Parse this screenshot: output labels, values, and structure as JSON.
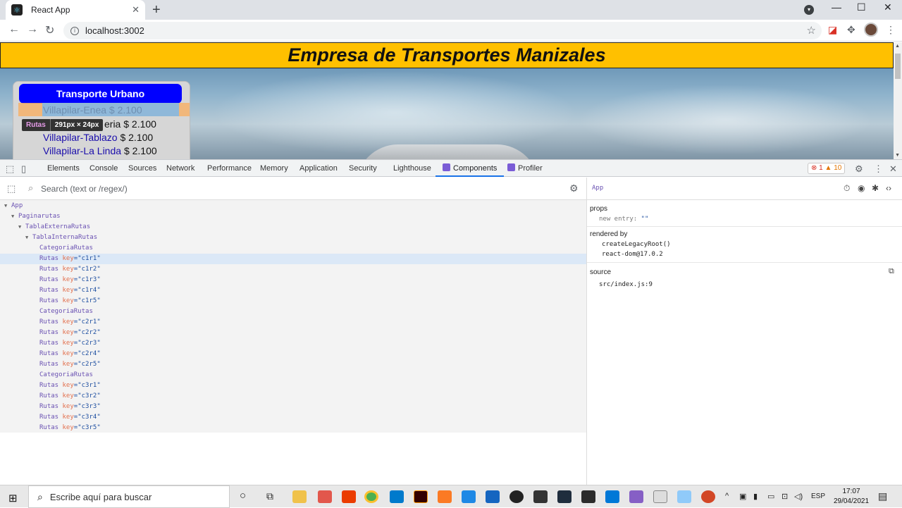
{
  "browser": {
    "tab_title": "React App",
    "tab_close": "✕",
    "new_tab": "+",
    "minimize": "—",
    "maximize": "☐",
    "close": "✕",
    "url": "localhost:3002"
  },
  "page": {
    "title": "Empresa de Transportes Manizales",
    "card_header": "Transporte Urbano",
    "routes": [
      {
        "name": "Villapilar-Enea",
        "price": "$ 2.100"
      },
      {
        "name": "Villapilar-Galeria",
        "price": "$ 2.100"
      },
      {
        "name": "Villapilar-Tablazo",
        "price": "$ 2.100"
      },
      {
        "name": "Villapilar-La Linda",
        "price": "$ 2.100"
      }
    ],
    "route2_visible": "eria $ 2.100",
    "tooltip": {
      "name": "Rutas",
      "size": "291px × 24px"
    }
  },
  "devtools": {
    "tabs": [
      "Elements",
      "Console",
      "Sources",
      "Network",
      "Performance",
      "Memory",
      "Application",
      "Security",
      "Lighthouse",
      "Components",
      "Profiler"
    ],
    "active_tab": "Components",
    "errors": "1",
    "warnings": "10",
    "search_placeholder": "Search (text or /regex/)",
    "tree": [
      {
        "name": "App",
        "depth": 0,
        "expandable": true
      },
      {
        "name": "Paginarutas",
        "depth": 1,
        "expandable": true
      },
      {
        "name": "TablaExternaRutas",
        "depth": 2,
        "expandable": true
      },
      {
        "name": "TablaInternaRutas",
        "depth": 3,
        "expandable": true
      },
      {
        "name": "CategoriaRutas",
        "depth": 4
      },
      {
        "name": "Rutas",
        "key": "c1r1",
        "depth": 4,
        "selected": true
      },
      {
        "name": "Rutas",
        "key": "c1r2",
        "depth": 4
      },
      {
        "name": "Rutas",
        "key": "c1r3",
        "depth": 4
      },
      {
        "name": "Rutas",
        "key": "c1r4",
        "depth": 4
      },
      {
        "name": "Rutas",
        "key": "c1r5",
        "depth": 4
      },
      {
        "name": "CategoriaRutas",
        "depth": 4
      },
      {
        "name": "Rutas",
        "key": "c2r1",
        "depth": 4
      },
      {
        "name": "Rutas",
        "key": "c2r2",
        "depth": 4
      },
      {
        "name": "Rutas",
        "key": "c2r3",
        "depth": 4
      },
      {
        "name": "Rutas",
        "key": "c2r4",
        "depth": 4
      },
      {
        "name": "Rutas",
        "key": "c2r5",
        "depth": 4
      },
      {
        "name": "CategoriaRutas",
        "depth": 4
      },
      {
        "name": "Rutas",
        "key": "c3r1",
        "depth": 4
      },
      {
        "name": "Rutas",
        "key": "c3r2",
        "depth": 4
      },
      {
        "name": "Rutas",
        "key": "c3r3",
        "depth": 4
      },
      {
        "name": "Rutas",
        "key": "c3r4",
        "depth": 4
      },
      {
        "name": "Rutas",
        "key": "c3r5",
        "depth": 4
      }
    ],
    "inspector": {
      "component": "App",
      "props_label": "props",
      "prop_key": "new entry:",
      "prop_value": "\"\"",
      "rendered_by_label": "rendered by",
      "rendered_by": [
        "createLegacyRoot()",
        "react-dom@17.0.2"
      ],
      "source_label": "source",
      "source": "src/index.js:9"
    }
  },
  "taskbar": {
    "search_placeholder": "Escribe aquí para buscar",
    "lang": "ESP",
    "time": "17:07",
    "date": "29/04/2021"
  },
  "colors": {
    "header_bg": "#ffc000",
    "card_header_bg": "#0000ff",
    "react_purple": "#6a51b2",
    "devtools_accent": "#1a73e8"
  }
}
